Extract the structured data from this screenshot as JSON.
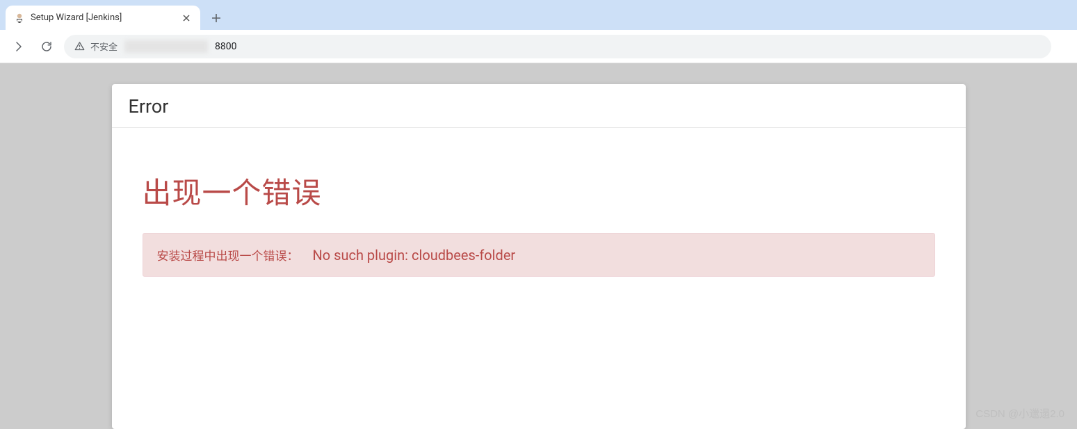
{
  "browser": {
    "tab": {
      "title": "Setup Wizard [Jenkins]",
      "favicon": "👤"
    },
    "address": {
      "security_label": "不安全",
      "url_suffix": "8800"
    }
  },
  "modal": {
    "header_title": "Error",
    "error_heading": "出现一个错误",
    "alert": {
      "label": "安装过程中出现一个错误：",
      "message": "No such plugin: cloudbees-folder"
    }
  },
  "watermark": "CSDN @小邋遢2.0"
}
